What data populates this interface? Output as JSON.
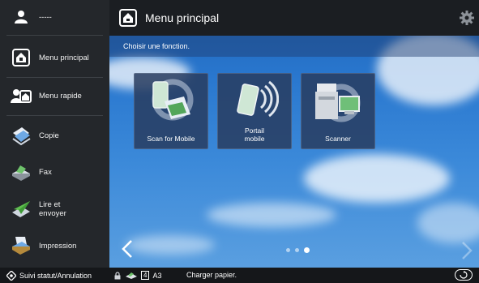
{
  "sidebar": {
    "user_label": "-----",
    "items": [
      {
        "label": "Menu principal",
        "icon": "home-icon"
      },
      {
        "label": "Menu rapide",
        "icon": "quick-menu-icon"
      },
      {
        "label": "Copie",
        "icon": "copy-icon"
      },
      {
        "label": "Fax",
        "icon": "fax-icon"
      },
      {
        "label": "Lire et\nenvoyer",
        "icon": "scan-send-icon"
      },
      {
        "label": "Impression",
        "icon": "print-icon"
      }
    ]
  },
  "header": {
    "title": "Menu principal"
  },
  "main": {
    "instruction": "Choisir une fonction.",
    "tiles": [
      {
        "label": "Scan for Mobile",
        "icon": "scan-for-mobile-icon"
      },
      {
        "label": "Portail\nmobile",
        "icon": "mobile-portal-icon"
      },
      {
        "label": "Scanner",
        "icon": "scanner-icon"
      }
    ],
    "pager": {
      "pages": 3,
      "current": 3
    }
  },
  "status_bar": {
    "status_link": "Suivi statut/Annulation",
    "tray_number": "4",
    "paper_size": "A3",
    "message": "Charger papier."
  },
  "colors": {
    "sidebar_bg": "#24272b",
    "topbar_bg": "#1b1e22",
    "sky": "#2a78cf"
  }
}
